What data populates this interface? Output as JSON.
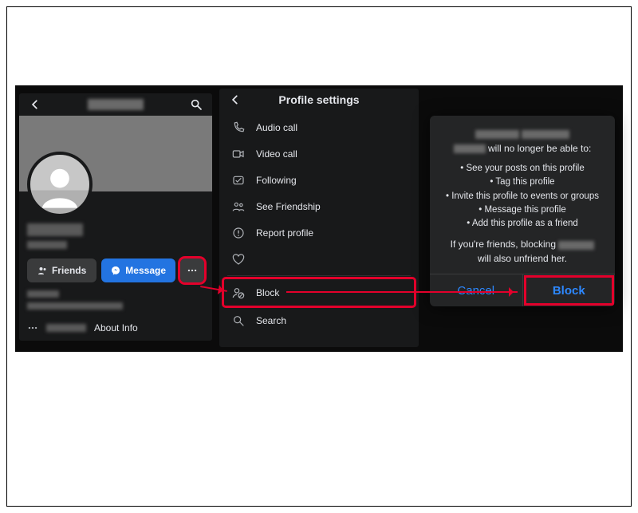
{
  "colors": {
    "highlight": "#e3002b",
    "primary": "#2374e1",
    "link": "#2d88ff"
  },
  "panel1": {
    "friends_btn": "Friends",
    "message_btn": "Message",
    "about_label": "About Info"
  },
  "panel2": {
    "title": "Profile settings",
    "items": [
      {
        "icon": "phone",
        "label": "Audio call"
      },
      {
        "icon": "video",
        "label": "Video call"
      },
      {
        "icon": "check",
        "label": "Following"
      },
      {
        "icon": "people",
        "label": "See Friendship"
      },
      {
        "icon": "flag",
        "label": "Report profile"
      },
      {
        "icon": "heart",
        "label": ""
      },
      {
        "icon": "block",
        "label": "Block"
      },
      {
        "icon": "search",
        "label": "Search"
      }
    ]
  },
  "panel3": {
    "lead_suffix": " will no longer be able to:",
    "bullets": [
      "See your posts on this profile",
      "Tag this profile",
      "Invite this profile to events or groups",
      "Message this profile",
      "Add this profile as a friend"
    ],
    "foot_prefix": "If you're friends, blocking ",
    "foot_suffix": "will also unfriend her.",
    "cancel": "Cancel",
    "block": "Block"
  }
}
